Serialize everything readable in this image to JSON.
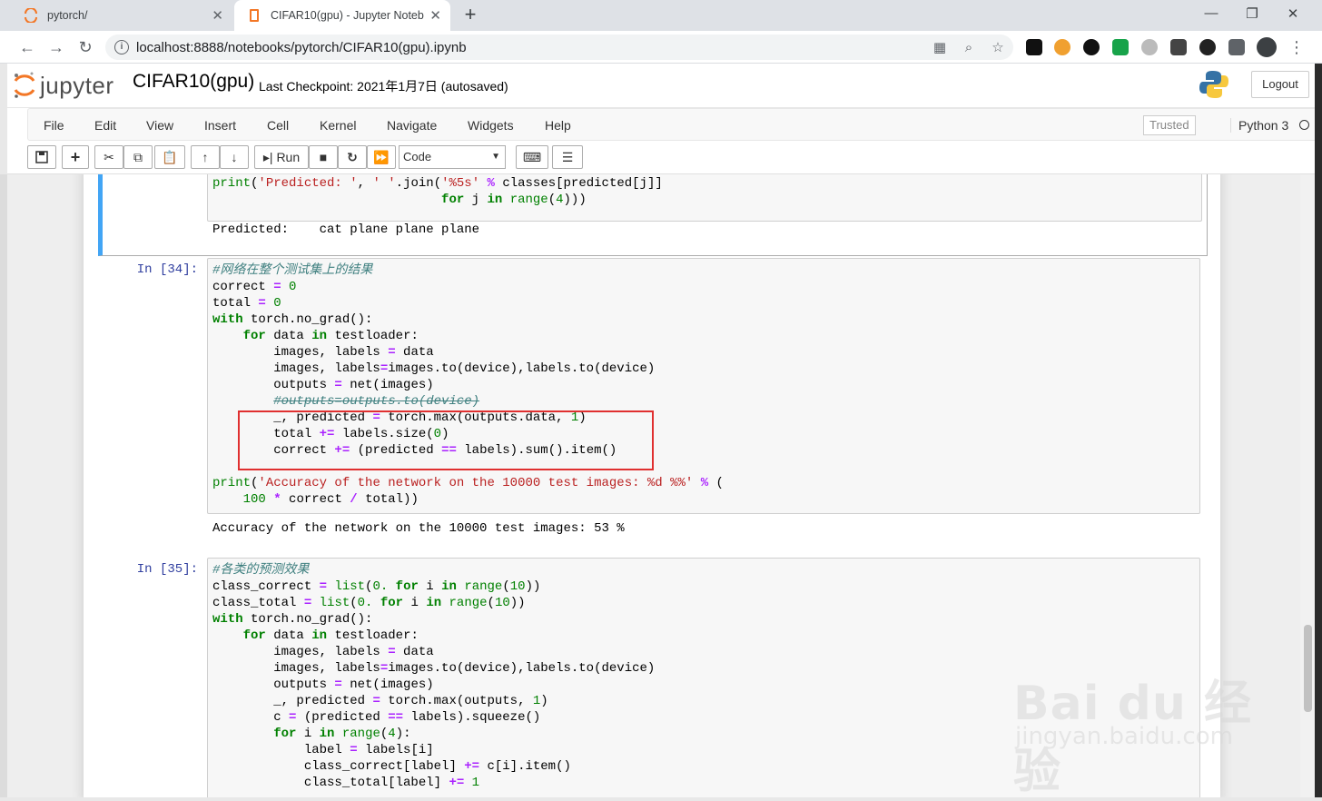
{
  "browser": {
    "tabs": [
      {
        "title": "pytorch/"
      },
      {
        "title": "CIFAR10(gpu) - Jupyter Noteb"
      }
    ],
    "url": "localhost:8888/notebooks/pytorch/CIFAR10(gpu).ipynb"
  },
  "jupyter": {
    "logo_text": "jupyter",
    "notebook_name": "CIFAR10(gpu)",
    "checkpoint": "Last Checkpoint: 2021年1月7日   (autosaved)",
    "logout_label": "Logout",
    "menu": [
      "File",
      "Edit",
      "View",
      "Insert",
      "Cell",
      "Kernel",
      "Navigate",
      "Widgets",
      "Help"
    ],
    "trusted_label": "Trusted",
    "kernel_name": "Python 3",
    "toolbar": {
      "run_label": "Run",
      "cell_type": "Code"
    }
  },
  "cells": {
    "prev": {
      "code_line1": "print('Predicted: ', ' '.join('%5s' % classes[predicted[j]]",
      "code_line2": "                              for j in range(4)))",
      "output": "Predicted:    cat plane plane plane"
    },
    "c34": {
      "prompt": "In [34]:",
      "output": "Accuracy of the network on the 10000 test images: 53 %"
    },
    "c35": {
      "prompt": "In [35]:"
    }
  },
  "watermark": {
    "text": "Bai du 经验",
    "sub": "jingyan.baidu.com"
  }
}
